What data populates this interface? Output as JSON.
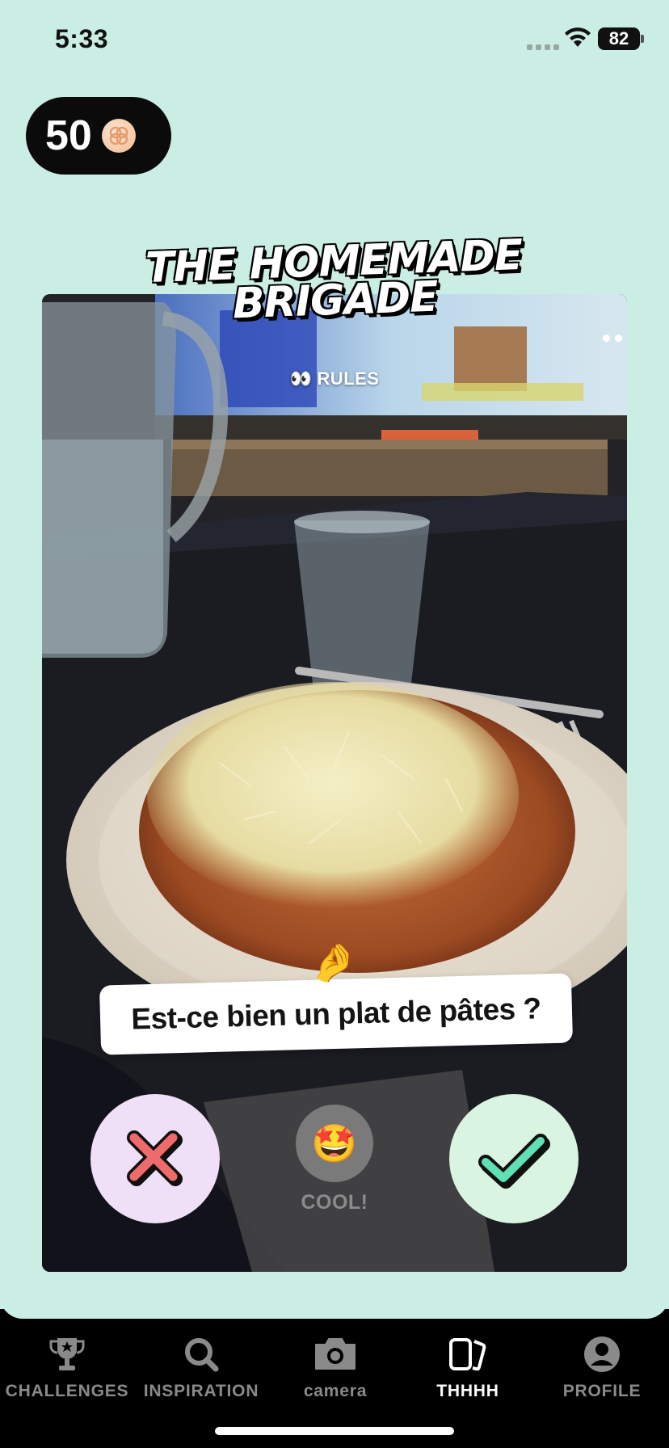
{
  "status_bar": {
    "time": "5:33",
    "battery": "82"
  },
  "coins": {
    "value": "50",
    "icon": "coin-icon"
  },
  "challenge": {
    "title_line1": "THE HOMEMADE",
    "title_line2": "BRIGADE",
    "rules_label": "RULES",
    "rules_icon": "👀",
    "question": "Est-ce bien un plat de pâtes ?",
    "pinch_icon": "🤌",
    "cool_icon": "🤩",
    "cool_label": "COOL!"
  },
  "nav": {
    "items": [
      {
        "label": "CHALLENGES",
        "icon": "trophy-icon"
      },
      {
        "label": "INSPIRATION",
        "icon": "search-icon"
      },
      {
        "label": "camera",
        "icon": "camera-icon"
      },
      {
        "label": "THHHH",
        "icon": "cards-icon",
        "active": true
      },
      {
        "label": "PROFILE",
        "icon": "profile-icon"
      }
    ]
  },
  "colors": {
    "background": "#cbeee4",
    "no_button": "#efe0f7",
    "yes_button": "#d9f4e0",
    "cross": "#ef6b6b",
    "check": "#5fe0b3"
  }
}
